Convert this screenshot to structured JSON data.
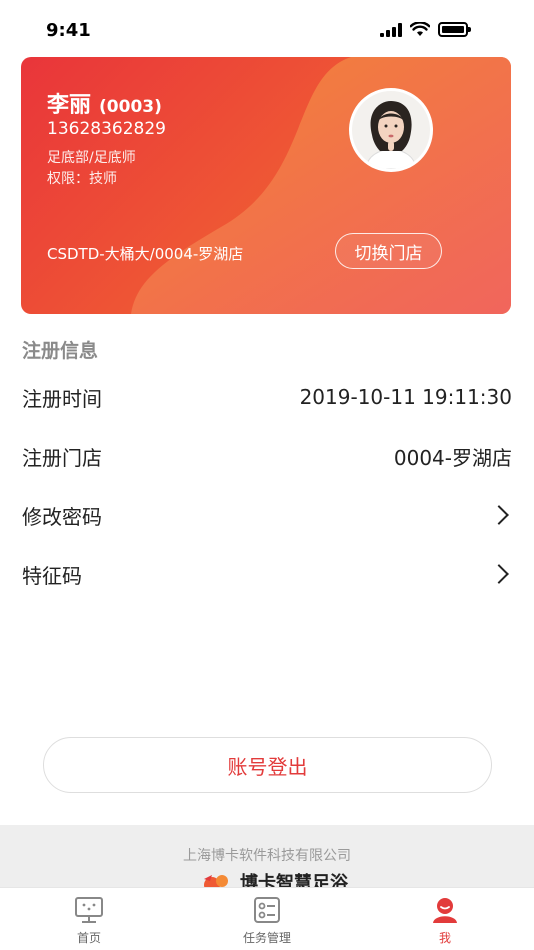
{
  "status_bar": {
    "time": "9:41"
  },
  "profile": {
    "name": "李丽",
    "id": "(0003)",
    "phone": "13628362829",
    "department": "足底部/足底师",
    "permission": "权限：技师",
    "store": "CSDTD-大桶大/0004-罗湖店",
    "switch_store_label": "切换门店",
    "avatar_icon": "person-avatar-icon"
  },
  "registration": {
    "section_title": "注册信息",
    "rows": [
      {
        "label": "注册时间",
        "value": "2019-10-11 19:11:30"
      },
      {
        "label": "注册门店",
        "value": "0004-罗湖店"
      },
      {
        "label": "修改密码",
        "value": ""
      },
      {
        "label": "特征码",
        "value": ""
      }
    ]
  },
  "logout_label": "账号登出",
  "footer": {
    "company": "上海博卡软件科技有限公司",
    "brand": "博卡智慧足浴"
  },
  "tabs": [
    {
      "label": "首页",
      "icon": "monitor-icon",
      "active": false
    },
    {
      "label": "任务管理",
      "icon": "task-list-icon",
      "active": false
    },
    {
      "label": "我",
      "icon": "user-icon",
      "active": true
    }
  ],
  "colors": {
    "accent": "#e23b3b",
    "card_start": "#e9353a",
    "card_end": "#f89a3a"
  }
}
